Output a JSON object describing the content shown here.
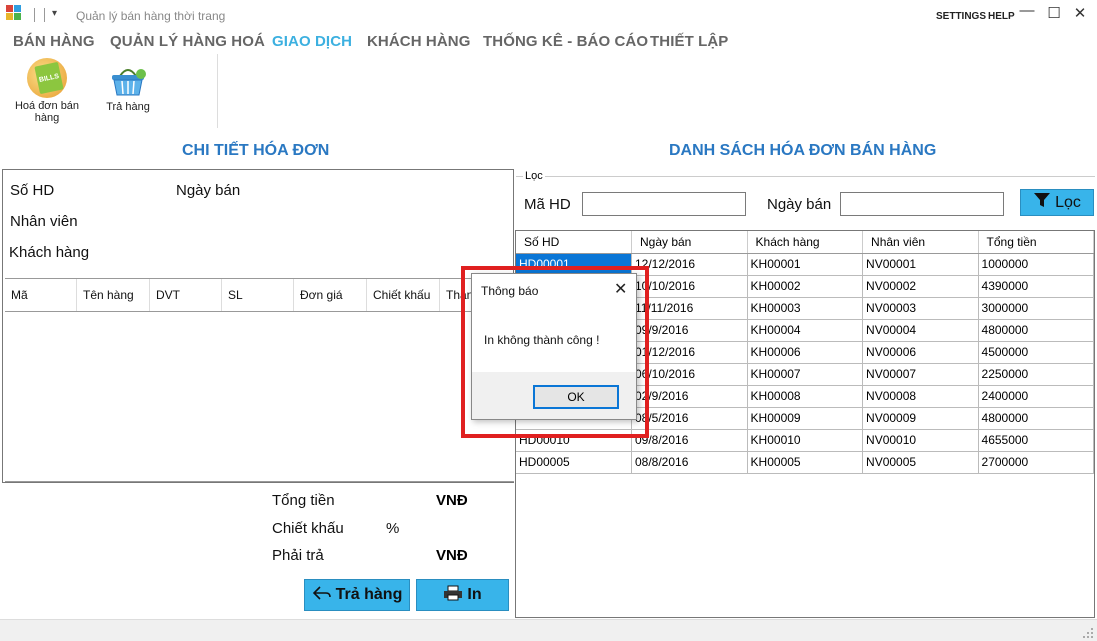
{
  "window": {
    "title": "Quản lý bán hàng thời trang",
    "settings_label": "SETTINGS",
    "help_label": "HELP",
    "minimize_glyph": "—",
    "maximize_glyph": "☐",
    "close_glyph": "✕",
    "dropdown_glyph": "▾"
  },
  "menu": [
    {
      "label": "BÁN HÀNG"
    },
    {
      "label": "QUẢN LÝ HÀNG HOÁ"
    },
    {
      "label": "GIAO DỊCH"
    },
    {
      "label": "KHÁCH HÀNG"
    },
    {
      "label": "THỐNG KÊ - BÁO CÁO"
    },
    {
      "label": "THIẾT LẬP"
    }
  ],
  "active_menu": "GIAO DỊCH",
  "ribbon": {
    "invoice_label": "Hoá đơn bán hàng",
    "invoice_icon_text": "BILLS",
    "return_label": "Trả hàng"
  },
  "left": {
    "title": "CHI TIẾT HÓA ĐƠN",
    "so_hd": "Số HD",
    "ngay_ban": "Ngày bán",
    "nhan_vien": "Nhân viên",
    "khach_hang": "Khách hàng",
    "columns": [
      "Mã",
      "Tên hàng",
      "DVT",
      "SL",
      "Đơn giá",
      "Chiết khấu",
      "Thành tiền"
    ],
    "tong_tien": "Tổng tiền",
    "chiet_khau": "Chiết khấu",
    "percent": "%",
    "phai_tra": "Phải trả",
    "currency": "VNĐ",
    "return_btn": "Trả hàng",
    "print_btn": "In"
  },
  "right": {
    "title": "DANH SÁCH HÓA ĐƠN BÁN HÀNG",
    "filter_group": "Lọc",
    "ma_hd_label": "Mã HD",
    "ngay_ban_label": "Ngày bán",
    "ma_hd_value": "",
    "ngay_ban_value": "",
    "filter_btn": "Lọc",
    "columns": [
      "Số HD",
      "Ngày bán",
      "Khách hàng",
      "Nhân viên",
      "Tổng tiền"
    ],
    "rows": [
      [
        "HD00001",
        "12/12/2016",
        "KH00001",
        "NV00001",
        "1000000"
      ],
      [
        "",
        "10/10/2016",
        "KH00002",
        "NV00002",
        "4390000"
      ],
      [
        "",
        "11/11/2016",
        "KH00003",
        "NV00003",
        "3000000"
      ],
      [
        "",
        "09/9/2016",
        "KH00004",
        "NV00004",
        "4800000"
      ],
      [
        "",
        "01/12/2016",
        "KH00006",
        "NV00006",
        "4500000"
      ],
      [
        "",
        "06/10/2016",
        "KH00007",
        "NV00007",
        "2250000"
      ],
      [
        "",
        "02/9/2016",
        "KH00008",
        "NV00008",
        "2400000"
      ],
      [
        "",
        "08/5/2016",
        "KH00009",
        "NV00009",
        "4800000"
      ],
      [
        "HD00010",
        "09/8/2016",
        "KH00010",
        "NV00010",
        "4655000"
      ],
      [
        "HD00005",
        "08/8/2016",
        "KH00005",
        "NV00005",
        "2700000"
      ]
    ]
  },
  "dialog": {
    "title": "Thông báo",
    "message": "In không thành công !",
    "ok": "OK",
    "close_glyph": "✕"
  },
  "colors": {
    "accent": "#38b4ea",
    "title_blue": "#2a78c2",
    "selection": "#0a76d6",
    "highlight": "#e02020"
  }
}
